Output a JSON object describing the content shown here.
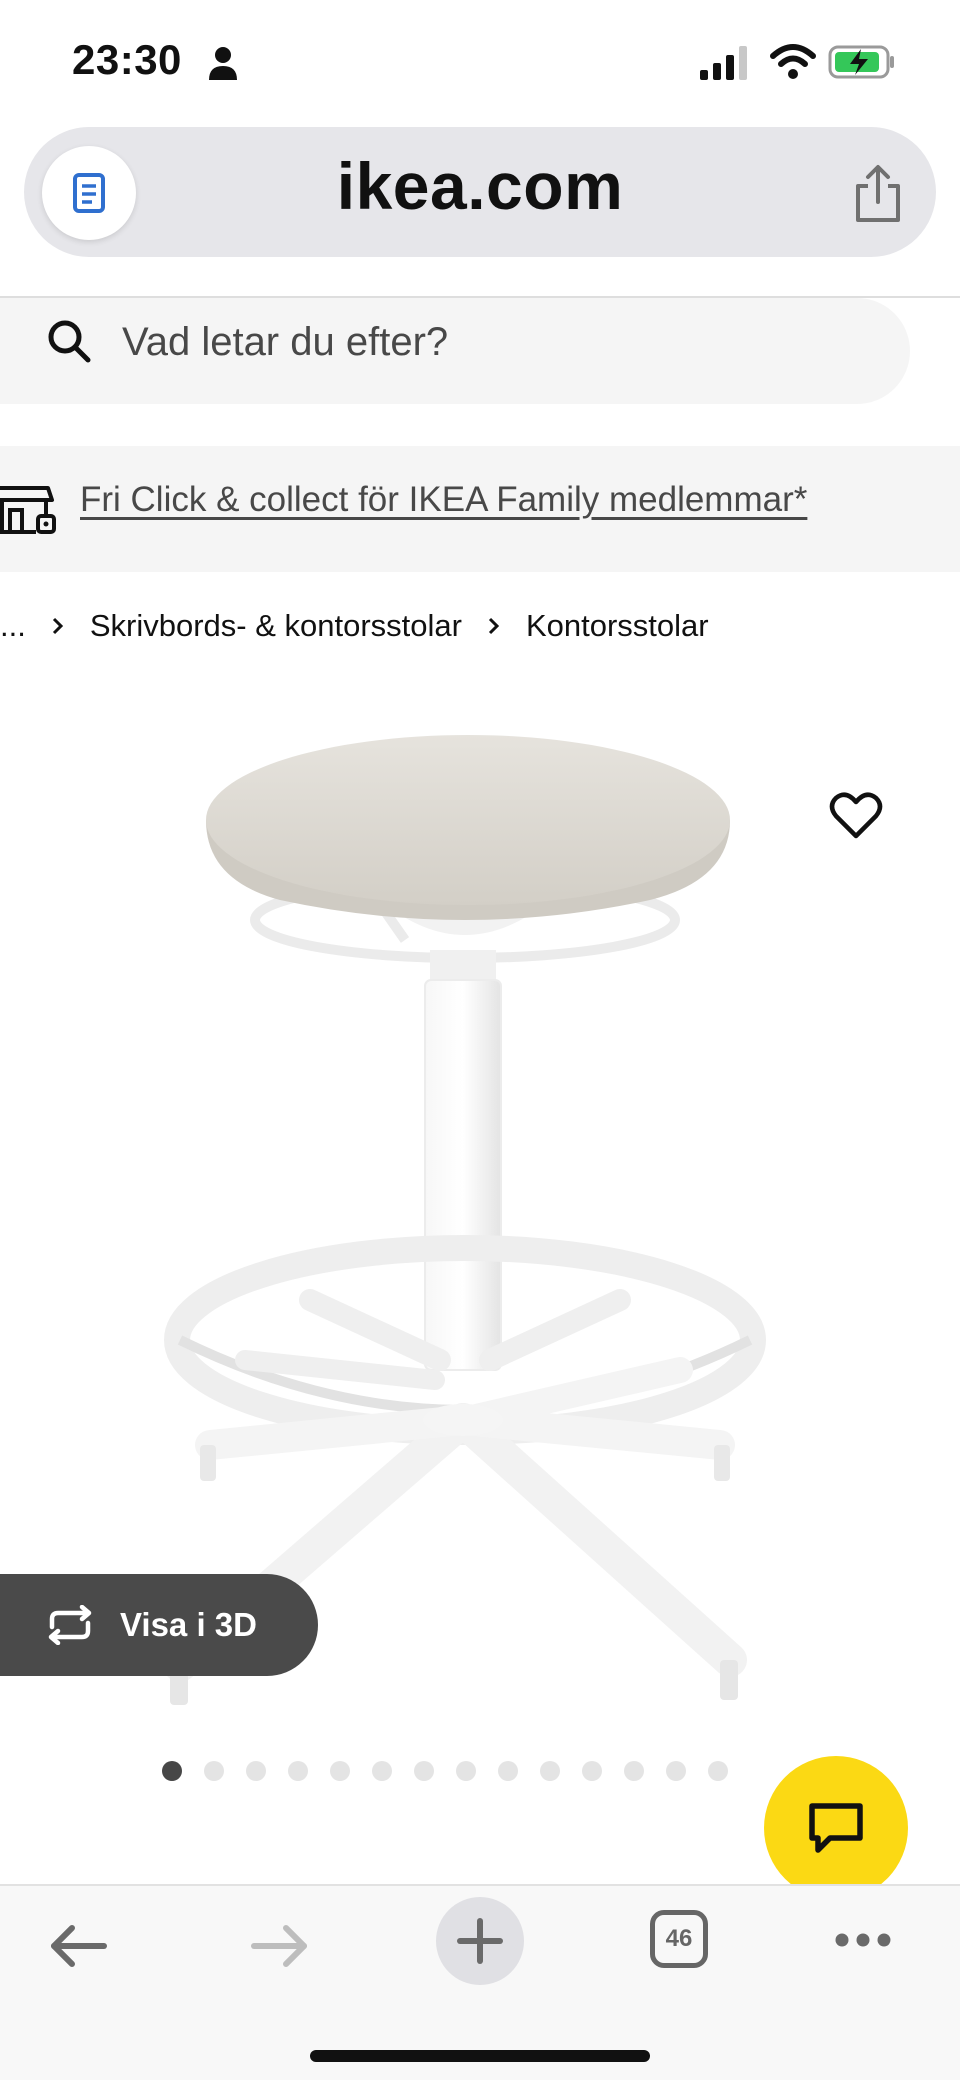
{
  "status_bar": {
    "time": "23:30",
    "icons": [
      "person-icon",
      "signal-icon",
      "wifi-icon",
      "battery-charging-icon"
    ]
  },
  "browser": {
    "url": "ikea.com",
    "icons": [
      "reader-icon",
      "share-icon"
    ]
  },
  "search": {
    "placeholder": "Vad letar du efter?",
    "icon": "search-icon"
  },
  "promo": {
    "text": "Fri Click & collect för IKEA Family medlemmar*",
    "icon": "store-icon"
  },
  "breadcrumb": {
    "items": [
      "...",
      "Skrivbords- & kontorsstolar",
      "Kontorsstolar"
    ]
  },
  "product": {
    "favorite_icon": "heart-icon",
    "view_3d_label": "Visa i 3D",
    "image_count": 14,
    "current_image": 1
  },
  "chat": {
    "icon": "chat-icon"
  },
  "toolbar": {
    "tab_count": "46",
    "icons": [
      "back-icon",
      "forward-icon",
      "new-tab-icon",
      "tabs-icon",
      "more-icon"
    ]
  },
  "colors": {
    "chat_yellow": "#fbd914",
    "view3d_bg": "#4a4a4a",
    "battery_green": "#34c759"
  }
}
